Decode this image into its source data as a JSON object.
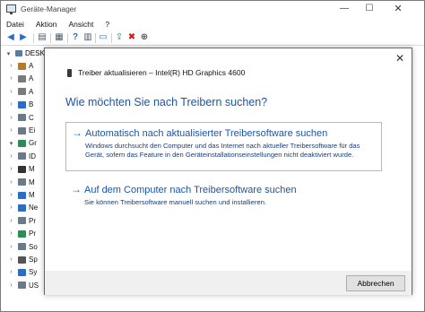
{
  "window": {
    "title": "Geräte-Manager",
    "minimize_glyph": "—",
    "maximize_glyph": "☐",
    "close_glyph": "✕"
  },
  "menubar": {
    "items": [
      "Datei",
      "Aktion",
      "Ansicht",
      "?"
    ]
  },
  "toolbar": {
    "back_glyph": "◀",
    "forward_glyph": "▶",
    "buttons": [
      {
        "name": "tree-view-icon",
        "glyph": "▤"
      },
      {
        "name": "properties-icon",
        "glyph": "▦"
      },
      {
        "name": "help-icon",
        "glyph": "?"
      },
      {
        "name": "device-view-icon",
        "glyph": "▥"
      },
      {
        "name": "monitor-icon",
        "glyph": "▭"
      },
      {
        "name": "update-driver-icon",
        "glyph": "⇪"
      },
      {
        "name": "uninstall-icon",
        "glyph": "✖"
      },
      {
        "name": "download-icon",
        "glyph": "⊕"
      }
    ]
  },
  "tree": {
    "root_label": "DESKT",
    "rows": [
      {
        "label": "A",
        "color": "#b07b32"
      },
      {
        "label": "A",
        "color": "#7b7b7b"
      },
      {
        "label": "A",
        "color": "#7b7b7b"
      },
      {
        "label": "B",
        "color": "#2a6cc6"
      },
      {
        "label": "C",
        "color": "#6a7a8a"
      },
      {
        "label": "Ei",
        "color": "#6a7a8a"
      },
      {
        "label": "Gr",
        "color": "#2e8b57"
      },
      {
        "label": "ID",
        "color": "#6a7a8a"
      },
      {
        "label": "M",
        "color": "#333333"
      },
      {
        "label": "M",
        "color": "#6a7a8a"
      },
      {
        "label": "M",
        "color": "#2a6cc6"
      },
      {
        "label": "Ne",
        "color": "#2a6cc6"
      },
      {
        "label": "Pr",
        "color": "#6a7a8a"
      },
      {
        "label": "Pr",
        "color": "#2e8b57"
      },
      {
        "label": "So",
        "color": "#6a7a8a"
      },
      {
        "label": "Sp",
        "color": "#555555"
      },
      {
        "label": "Sy",
        "color": "#2a6cc6"
      },
      {
        "label": "US",
        "color": "#6a7a8a"
      }
    ]
  },
  "dialog": {
    "close_glyph": "✕",
    "header": "Treiber aktualisieren – Intel(R) HD Graphics 4600",
    "question": "Wie möchten Sie nach Treibern suchen?",
    "option_arrow": "→",
    "option_auto": {
      "title": "Automatisch nach aktualisierter Treibersoftware suchen",
      "description": "Windows durchsucht den Computer und das Internet nach aktueller Treibersoftware für das Gerät, sofern das Feature in den Geräteinstallationseinstellungen nicht deaktiviert wurde."
    },
    "option_manual": {
      "title": "Auf dem Computer nach Treibersoftware suchen",
      "description": "Sie können Treibersoftware manuell suchen und installieren."
    },
    "cancel_label": "Abbrechen"
  }
}
